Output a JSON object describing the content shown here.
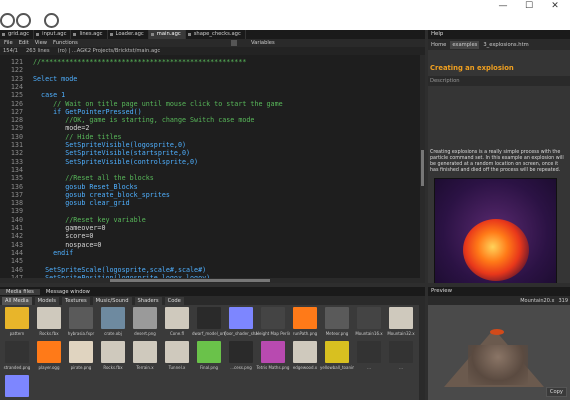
{
  "window": {
    "minimize": "—",
    "maximize": "☐",
    "close": "✕"
  },
  "tabs": [
    "grid.agc",
    "input.agc",
    "lines.agc",
    "Loader.agc",
    "main.agc",
    "shape_checks.agc"
  ],
  "menu": [
    "File",
    "Edit",
    "View",
    "Functions"
  ],
  "variables": {
    "label": "Variables"
  },
  "posbar": {
    "line": "154/1",
    "info": "263 lines",
    "path": "(ro) | ...AGK2 Projects/Bricktst/main.agc"
  },
  "code": {
    "line_numbers": [
      "121",
      "122",
      "123",
      "124",
      "125",
      "126",
      "127",
      "128",
      "129",
      "130",
      "131",
      "132",
      "133",
      "134",
      "135",
      "136",
      "137",
      "138",
      "139",
      "140",
      "141",
      "142",
      "143",
      "144",
      "145",
      "146",
      "147"
    ],
    "lines": [
      "//***************************************************",
      "",
      "Select mode",
      "",
      "  case 1",
      "     // Wait on title page until mouse click to start the game",
      "     if GetPointerPressed()",
      "        //OK, game is starting, change Switch case mode",
      "        mode=2",
      "        // Hide titles",
      "        SetSpriteVisible(logosprite,0)",
      "        SetSpriteVisible(startsprite,0)",
      "        SetSpriteVisible(controlsprite,0)",
      "",
      "        //Reset all the blocks",
      "        gosub Reset_Blocks",
      "        gosub create_block_sprites",
      "        gosub clear_grid",
      "",
      "        //Reset key variable",
      "        gameover=0",
      "        score=0",
      "        nospace=0",
      "     endif",
      "",
      "   SetSpriteScale(logosprite,scale#,scale#)",
      "   SetSpritePosition(logosprite,logox,logoy)"
    ]
  },
  "help": {
    "panel_title": "Help",
    "nav": [
      "Home",
      "examples",
      "3_explosions.htm"
    ],
    "title": "Creating an explosion",
    "section": "Description",
    "text": "Creating explosions is a really simple process with the particle command set. In this example an explosion will be generated at a random location on screen, once it has finished and died off the process will be repeated."
  },
  "media": {
    "tabs": [
      "Media files",
      "Message window"
    ],
    "filters": [
      "All Media",
      "Models",
      "Textures",
      "Music/Sound",
      "Shaders",
      "Code"
    ],
    "items": [
      {
        "label": "pattern",
        "color": "#e8b52a"
      },
      {
        "label": "Rocks.fbx",
        "color": "#cfc9bd"
      },
      {
        "label": "hybrasia.fxpr",
        "color": "#5a5a5a"
      },
      {
        "label": "crate.obj",
        "color": "#6e8aa0"
      },
      {
        "label": "desert.png",
        "color": "#9a9a9a"
      },
      {
        "label": "Cone.fl",
        "color": "#cfc9bd"
      },
      {
        "label": "dwarf_model_on_walk.png",
        "color": "#2a2a2a"
      },
      {
        "label": "floor_shader_shared.jpg",
        "color": "#7d86ff"
      },
      {
        "label": "Height Map Perlin.fx",
        "color": "#444"
      },
      {
        "label": "runPath.png",
        "color": "#ff7a18"
      },
      {
        "label": "Meteor.png",
        "color": "#5a5a5a"
      },
      {
        "label": "Mountain16.x",
        "color": "#444"
      },
      {
        "label": "Mountain32.x",
        "color": "#cfc9bd"
      },
      {
        "label": "stranded.png",
        "color": "#333"
      },
      {
        "label": "player.ogg",
        "color": "#ff7a18"
      },
      {
        "label": "pirate.png",
        "color": "#e0d4c0"
      },
      {
        "label": "Rocks.fbx",
        "color": "#cfc9bd"
      },
      {
        "label": "Terrain.x",
        "color": "#cfc9bd"
      },
      {
        "label": "Tunnel.x",
        "color": "#cfc9bd"
      },
      {
        "label": "Final.png",
        "color": "#6ac24a"
      },
      {
        "label": "...cess.png",
        "color": "#2a2a2a"
      },
      {
        "label": "Tetris Maths.png",
        "color": "#b84ab0"
      },
      {
        "label": "edgewood.x",
        "color": "#cfc9bd"
      },
      {
        "label": "yellowball_toanim.png",
        "color": "#d8c020"
      },
      {
        "label": "...",
        "color": "#333"
      },
      {
        "label": "...",
        "color": "#333"
      },
      {
        "label": "...",
        "color": "#7d86ff"
      }
    ]
  },
  "preview": {
    "panel_title": "Preview",
    "file": "Mountain20.x",
    "zoom": "319",
    "copy_label": "Copy"
  },
  "colors": {
    "comment": "#58b85a",
    "keyword": "#4fb0ff",
    "text": "#d6d6d6",
    "accent": "#f0a020"
  }
}
